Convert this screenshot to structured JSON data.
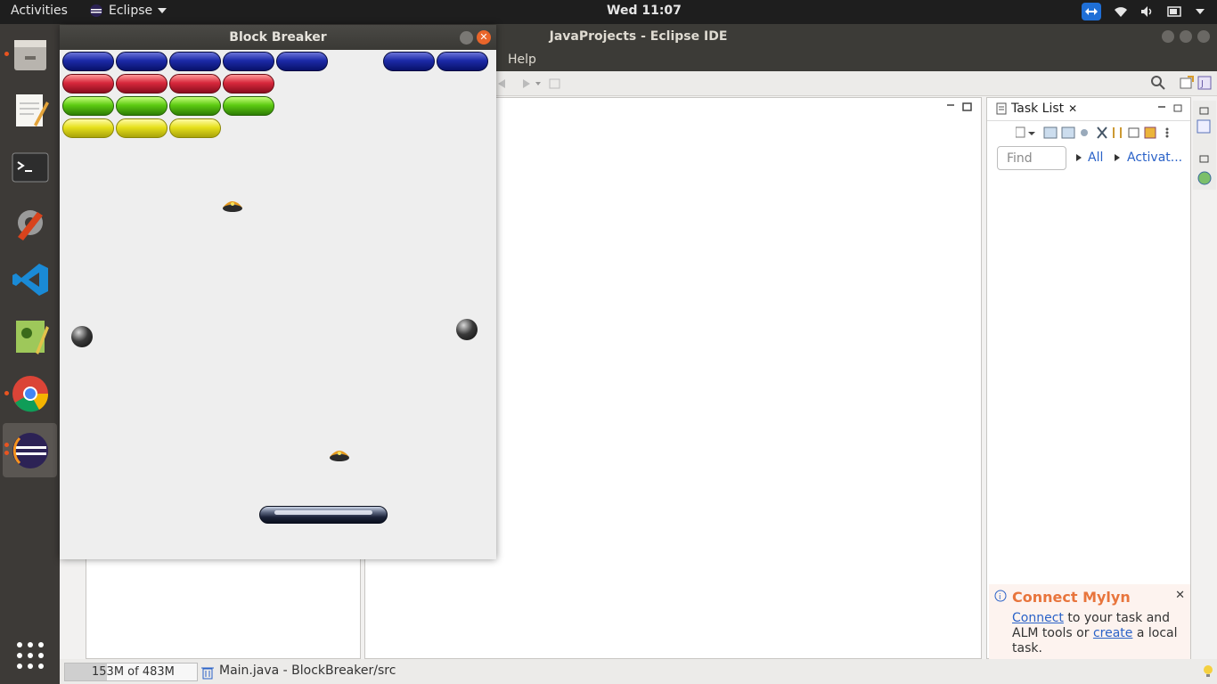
{
  "topbar": {
    "activities": "Activities",
    "app_name": "Eclipse",
    "clock": "Wed 11:07"
  },
  "dock": {
    "items": [
      "files-icon",
      "text-editor-icon",
      "terminal-icon",
      "settings-icon",
      "vscode-icon",
      "image-editor-icon",
      "chrome-icon",
      "eclipse-icon",
      "app-grid-icon"
    ]
  },
  "eclipse": {
    "title": "JavaProjects - Eclipse IDE",
    "menu_help": "Help",
    "task_list": {
      "tab": "Task List",
      "find_placeholder": "Find",
      "all": "All",
      "activate": "Activat..."
    },
    "mylyn": {
      "title": "Connect Mylyn",
      "connect": "Connect",
      "text1": " to your task and ALM tools or ",
      "create": "create",
      "text2": " a local task."
    },
    "status": {
      "heap": "153M of 483M",
      "heap_fraction": 0.32,
      "file": "Main.java - BlockBreaker/src"
    }
  },
  "game": {
    "title": "Block Breaker",
    "colors": {
      "blue": "#1c2aa8",
      "red": "#d8283c",
      "green": "#5dcb12",
      "yellow": "#e6e01c"
    },
    "rows": [
      {
        "color": "blue",
        "bricks": [
          1,
          1,
          1,
          1,
          1,
          0,
          1,
          1
        ]
      },
      {
        "color": "red",
        "bricks": [
          1,
          1,
          1,
          1,
          0,
          0,
          0,
          0
        ]
      },
      {
        "color": "green",
        "bricks": [
          1,
          1,
          1,
          1,
          0,
          0,
          0,
          0
        ]
      },
      {
        "color": "yellow",
        "bricks": [
          1,
          1,
          1,
          0,
          0,
          0,
          0,
          0
        ]
      }
    ]
  }
}
